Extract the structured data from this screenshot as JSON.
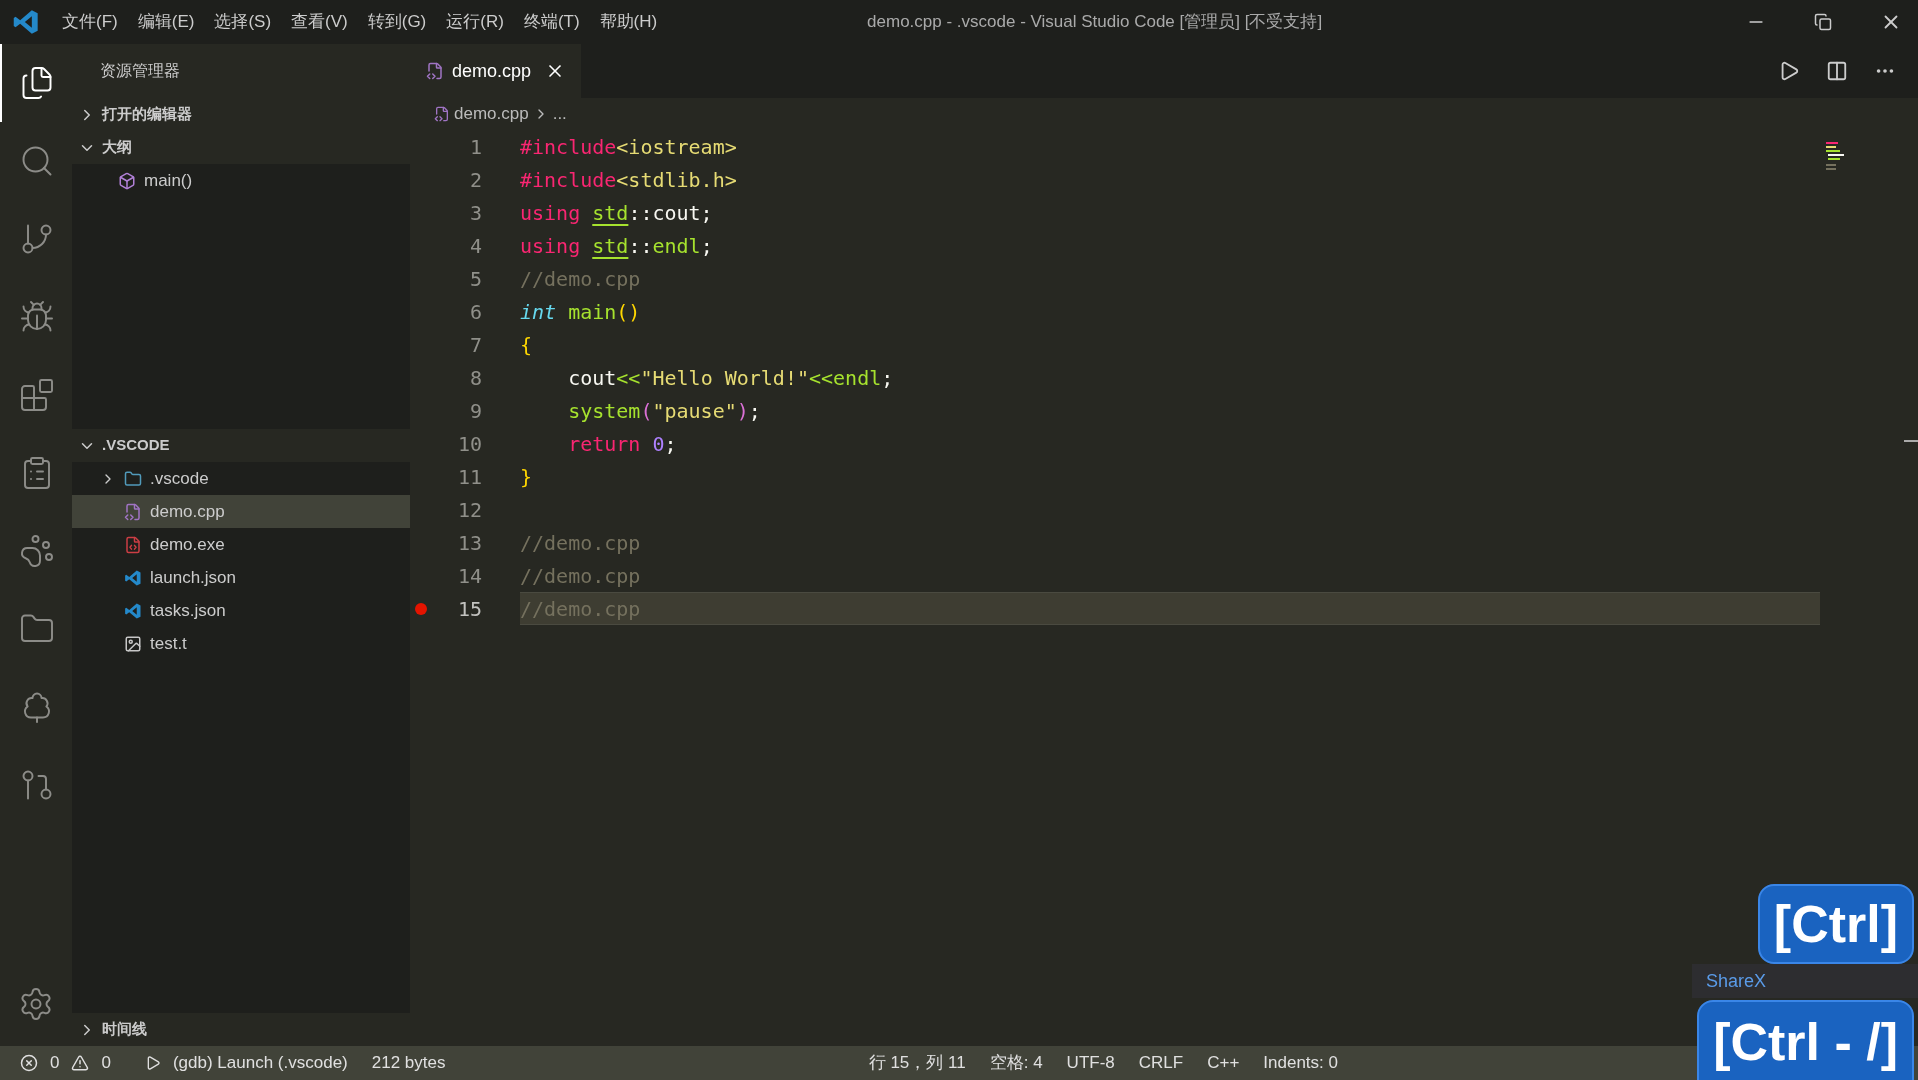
{
  "window": {
    "title": "demo.cpp - .vscode - Visual Studio Code [管理员] [不受支持]"
  },
  "menu": [
    "文件(F)",
    "编辑(E)",
    "选择(S)",
    "查看(V)",
    "转到(G)",
    "运行(R)",
    "终端(T)",
    "帮助(H)"
  ],
  "activity_bar": [
    {
      "kind": "files",
      "selected": true
    },
    {
      "kind": "search",
      "selected": false
    },
    {
      "kind": "git",
      "selected": false
    },
    {
      "kind": "debug",
      "selected": false
    },
    {
      "kind": "extensions",
      "selected": false
    },
    {
      "kind": "tasks",
      "selected": false
    },
    {
      "kind": "paw",
      "selected": false
    },
    {
      "kind": "folder",
      "selected": false
    },
    {
      "kind": "tree",
      "selected": false
    },
    {
      "kind": "gitgraph",
      "selected": false
    }
  ],
  "sidebar": {
    "title": "资源管理器",
    "sections": [
      {
        "label": "打开的编辑器",
        "expanded": false
      },
      {
        "label": "大纲",
        "expanded": true,
        "items": [
          {
            "label": "main()"
          }
        ]
      }
    ],
    "folder": {
      "label": ".VSCODE",
      "expanded": true,
      "items": [
        {
          "label": ".vscode",
          "kind": "folder",
          "expanded": false,
          "selected": false
        },
        {
          "label": "demo.cpp",
          "kind": "cpp",
          "selected": true
        },
        {
          "label": "demo.exe",
          "kind": "exe",
          "selected": false
        },
        {
          "label": "launch.json",
          "kind": "vscode",
          "selected": false
        },
        {
          "label": "tasks.json",
          "kind": "vscode",
          "selected": false
        },
        {
          "label": "test.t",
          "kind": "camel",
          "selected": false
        }
      ]
    },
    "timeline": {
      "label": "时间线",
      "expanded": false
    }
  },
  "tabs": [
    {
      "label": "demo.cpp",
      "selected": true
    }
  ],
  "breadcrumb": [
    "demo.cpp",
    "..."
  ],
  "code": [
    {
      "number": "1",
      "breakpoint": false,
      "current": false,
      "tokens": [
        {
          "kind": "keyword",
          "text": "#include"
        },
        {
          "kind": "string",
          "text": "<iostream>"
        }
      ]
    },
    {
      "number": "2",
      "breakpoint": false,
      "current": false,
      "tokens": [
        {
          "kind": "keyword",
          "text": "#include"
        },
        {
          "kind": "string",
          "text": "<stdlib.h>"
        }
      ]
    },
    {
      "number": "3",
      "breakpoint": false,
      "current": false,
      "tokens": [
        {
          "kind": "keyword",
          "text": "using"
        },
        {
          "kind": "namespace",
          "text": "std",
          "gap": true
        },
        {
          "kind": "plain",
          "text": "::cout;"
        }
      ]
    },
    {
      "number": "4",
      "breakpoint": false,
      "current": false,
      "tokens": [
        {
          "kind": "keyword",
          "text": "using"
        },
        {
          "kind": "namespace",
          "text": "std",
          "gap": true
        },
        {
          "kind": "plain",
          "text": "::"
        },
        {
          "kind": "func",
          "text": "endl"
        },
        {
          "kind": "plain",
          "text": ";"
        }
      ]
    },
    {
      "number": "5",
      "breakpoint": false,
      "current": false,
      "tokens": [
        {
          "kind": "comment",
          "text": "//demo.cpp"
        }
      ]
    },
    {
      "number": "6",
      "breakpoint": false,
      "current": false,
      "tokens": [
        {
          "kind": "type",
          "text": "int"
        },
        {
          "kind": "func",
          "text": "main",
          "gap": true
        },
        {
          "kind": "bracket",
          "text": "()"
        }
      ]
    },
    {
      "number": "7",
      "breakpoint": false,
      "current": false,
      "tokens": [
        {
          "kind": "bracket",
          "text": "{"
        }
      ]
    },
    {
      "number": "8",
      "breakpoint": false,
      "current": false,
      "indent": true,
      "tokens": [
        {
          "kind": "plain",
          "text": "cout"
        },
        {
          "kind": "func",
          "text": "<<"
        },
        {
          "kind": "string",
          "text": "\"Hello World!\""
        },
        {
          "kind": "func",
          "text": "<<endl"
        },
        {
          "kind": "plain",
          "text": ";"
        }
      ]
    },
    {
      "number": "9",
      "breakpoint": false,
      "current": false,
      "indent": true,
      "tokens": [
        {
          "kind": "func",
          "text": "system"
        },
        {
          "kind": "bracket2",
          "text": "("
        },
        {
          "kind": "string",
          "text": "\"pause\""
        },
        {
          "kind": "bracket2",
          "text": ")"
        },
        {
          "kind": "plain",
          "text": ";"
        }
      ]
    },
    {
      "number": "10",
      "breakpoint": false,
      "current": false,
      "indent": true,
      "tokens": [
        {
          "kind": "keyword",
          "text": "return"
        },
        {
          "kind": "number",
          "text": "0",
          "gap": true
        },
        {
          "kind": "plain",
          "text": ";"
        }
      ]
    },
    {
      "number": "11",
      "breakpoint": false,
      "current": false,
      "tokens": [
        {
          "kind": "bracket",
          "text": "}"
        }
      ]
    },
    {
      "number": "12",
      "breakpoint": false,
      "current": false
    },
    {
      "number": "13",
      "breakpoint": false,
      "current": false,
      "tokens": [
        {
          "kind": "comment",
          "text": "//demo.cpp"
        }
      ]
    },
    {
      "number": "14",
      "breakpoint": false,
      "current": false,
      "tokens": [
        {
          "kind": "comment",
          "text": "//demo.cpp"
        }
      ]
    },
    {
      "number": "15",
      "breakpoint": true,
      "current": true,
      "tokens": [
        {
          "kind": "comment",
          "text": "//demo.cpp"
        }
      ]
    }
  ],
  "status_bar": {
    "errors": "0",
    "warnings": "0",
    "launch": "(gdb) Launch (.vscode)",
    "size": "212 bytes",
    "right": [
      "行 15，列 11",
      "空格: 4",
      "UTF-8",
      "CRLF",
      "C++",
      "Indents: 0"
    ]
  },
  "overlay": {
    "sharex": "ShareX",
    "keys": [
      "[Ctrl]",
      "[Ctrl - /]"
    ]
  }
}
